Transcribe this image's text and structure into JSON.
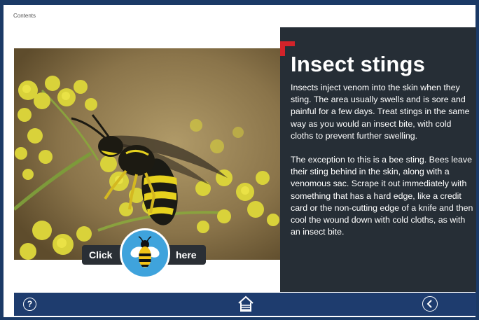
{
  "nav": {
    "contents_label": "Contents"
  },
  "panel": {
    "title": "Insect stings",
    "paragraphs": [
      "Insects inject venom into the skin when they sting. The area usually swells and is sore and painful for a few days. Treat stings in the same way as you would an insect bite, with cold cloths to prevent further swelling.",
      "The exception to this is a bee sting. Bees leave their sting behind in the skin, along with a venomous sac. Scrape it out immediately with something that has a hard edge, like a credit card or the non-cutting edge of a knife and then cool the wound down with cold cloths, as with an insect bite."
    ],
    "accent_color": "#d2232a",
    "background_color": "#262e36"
  },
  "widget": {
    "click_label": "Click",
    "here_label": "here",
    "icon": "bee-icon",
    "button_color": "#3fa3dc"
  },
  "bottom_bar": {
    "help_label": "?",
    "help_icon": "question-circle-icon",
    "home_icon": "home-icon",
    "back_icon": "back-arrow-circle-icon",
    "color": "#1e3c6e"
  },
  "photo": {
    "subject": "wasp-on-flowers-image"
  }
}
